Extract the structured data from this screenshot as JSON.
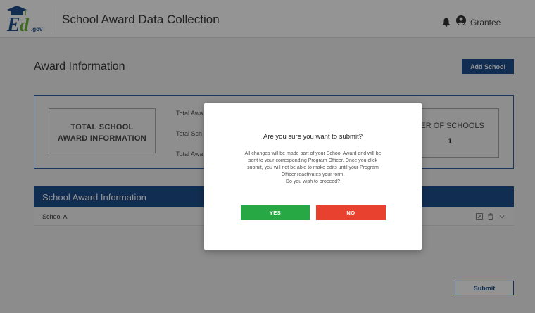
{
  "header": {
    "logo_text": "Ed.gov",
    "title": "School Award Data Collection",
    "user_name": "Grantee",
    "bell_icon": "bell-icon",
    "user_icon": "user-circle-icon"
  },
  "page": {
    "title": "Award Information",
    "add_school_label": "Add School",
    "submit_label": "Submit"
  },
  "summary": {
    "total_label_line1": "TOTAL SCHOOL",
    "total_label_line2": "AWARD INFORMATION",
    "stats": [
      "Total Awa",
      "Total Sch",
      "Total Awa"
    ],
    "schools_label": "BER OF SCHOOLS",
    "schools_value": "1"
  },
  "section": {
    "title": "School Award Information",
    "rows": [
      {
        "name": "School A"
      }
    ]
  },
  "modal": {
    "title": "Are you sure you want to submit?",
    "body_lines": [
      "All changes will be made part of your School Award and will be",
      "sent to your corresponding Program Officer. Once you click",
      "submit, you will not be able to make edits until your Program",
      "Officer reactivates your form.",
      "Do you wish to proceed?"
    ],
    "yes_label": "YES",
    "no_label": "NO"
  },
  "colors": {
    "primary": "#1e4e8c",
    "yes": "#28a745",
    "no": "#e8412f"
  }
}
